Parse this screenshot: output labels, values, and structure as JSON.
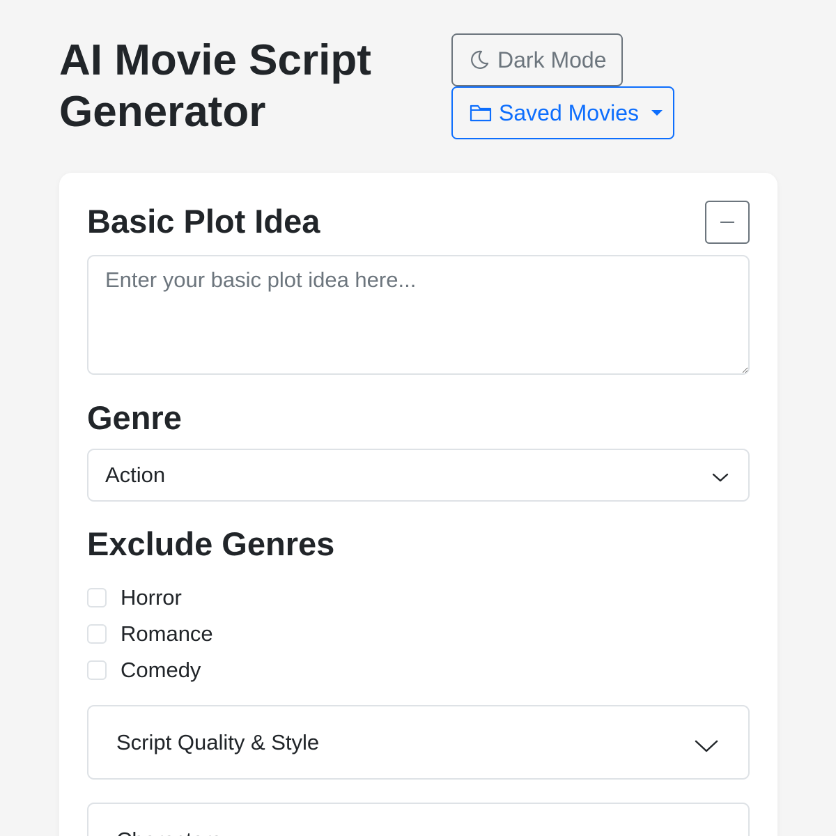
{
  "app": {
    "title": "AI Movie Script Generator"
  },
  "header": {
    "dark_mode_label": "Dark Mode",
    "dark_mode_icon": "moon-icon",
    "saved_movies_label": "Saved Movies",
    "saved_movies_icon": "folder-icon"
  },
  "plot": {
    "heading": "Basic Plot Idea",
    "placeholder": "Enter your basic plot idea here...",
    "value": ""
  },
  "genre": {
    "heading": "Genre",
    "selected": "Action"
  },
  "exclude": {
    "heading": "Exclude Genres",
    "options": [
      {
        "label": "Horror",
        "checked": false
      },
      {
        "label": "Romance",
        "checked": false
      },
      {
        "label": "Comedy",
        "checked": false
      }
    ]
  },
  "accordions": [
    {
      "label": "Script Quality & Style",
      "expanded": false
    },
    {
      "label": "Characters",
      "expanded": false
    }
  ],
  "colors": {
    "primary": "#0d6efd",
    "secondary": "#6c757d",
    "background": "#f5f5f5",
    "card": "#ffffff",
    "border": "#dee2e6",
    "text": "#212529"
  }
}
